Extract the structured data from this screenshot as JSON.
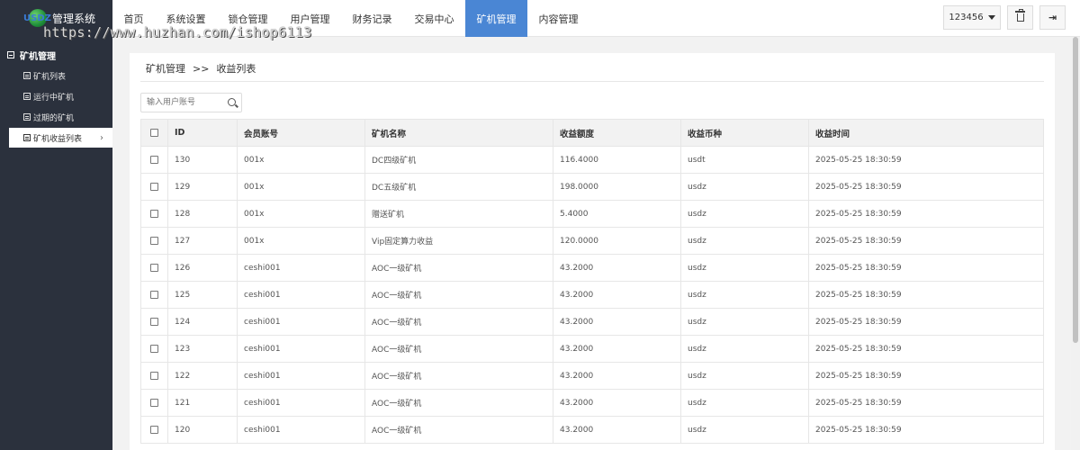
{
  "logo": {
    "mark_text": "USDZ",
    "title": "管理系统"
  },
  "watermark": "https://www.huzhan.com/ishop6113",
  "nav": {
    "items": [
      "首页",
      "系统设置",
      "锁仓管理",
      "用户管理",
      "财务记录",
      "交易中心",
      "矿机管理",
      "内容管理"
    ],
    "active_index": 6
  },
  "header": {
    "username": "123456"
  },
  "sidebar": {
    "group_title": "矿机管理",
    "items": [
      "矿机列表",
      "运行中矿机",
      "过期的矿机",
      "矿机收益列表"
    ],
    "active_index": 3
  },
  "breadcrumb": {
    "parent": "矿机管理",
    "separator": ">>",
    "current": "收益列表"
  },
  "search": {
    "placeholder": "输入用户账号"
  },
  "table": {
    "columns": [
      "ID",
      "会员账号",
      "矿机名称",
      "收益额度",
      "收益币种",
      "收益时间"
    ],
    "rows": [
      [
        "130",
        "001x",
        "DC四级矿机",
        "116.4000",
        "usdt",
        "2025-05-25 18:30:59"
      ],
      [
        "129",
        "001x",
        "DC五级矿机",
        "198.0000",
        "usdz",
        "2025-05-25 18:30:59"
      ],
      [
        "128",
        "001x",
        "赠送矿机",
        "5.4000",
        "usdz",
        "2025-05-25 18:30:59"
      ],
      [
        "127",
        "001x",
        "Vip固定算力收益",
        "120.0000",
        "usdz",
        "2025-05-25 18:30:59"
      ],
      [
        "126",
        "ceshi001",
        "AOC一级矿机",
        "43.2000",
        "usdz",
        "2025-05-25 18:30:59"
      ],
      [
        "125",
        "ceshi001",
        "AOC一级矿机",
        "43.2000",
        "usdz",
        "2025-05-25 18:30:59"
      ],
      [
        "124",
        "ceshi001",
        "AOC一级矿机",
        "43.2000",
        "usdz",
        "2025-05-25 18:30:59"
      ],
      [
        "123",
        "ceshi001",
        "AOC一级矿机",
        "43.2000",
        "usdz",
        "2025-05-25 18:30:59"
      ],
      [
        "122",
        "ceshi001",
        "AOC一级矿机",
        "43.2000",
        "usdz",
        "2025-05-25 18:30:59"
      ],
      [
        "121",
        "ceshi001",
        "AOC一级矿机",
        "43.2000",
        "usdz",
        "2025-05-25 18:30:59"
      ],
      [
        "120",
        "ceshi001",
        "AOC一级矿机",
        "43.2000",
        "usdz",
        "2025-05-25 18:30:59"
      ]
    ]
  },
  "colors": {
    "sidebar_bg": "#2b313d",
    "nav_active": "#4a86d4",
    "page_bg": "#f2f2f2"
  }
}
